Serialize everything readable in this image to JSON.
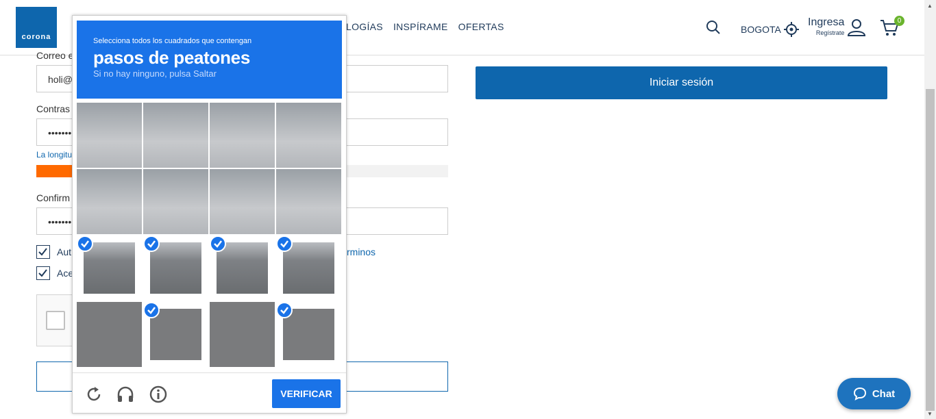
{
  "header": {
    "logo_text": "corona",
    "nav": [
      "LOGÍAS",
      "INSPÍRAME",
      "OFERTAS"
    ],
    "city": "BOGOTA",
    "login_label": "Ingresa",
    "login_sub": "Regístrate",
    "cart_count": "0"
  },
  "form": {
    "email_label": "Correo e",
    "email_value": "holi@",
    "password_label": "Contras",
    "password_value": "•••••••",
    "hint": "La longitu",
    "confirm_label": "Confirm",
    "confirm_value": "•••••••",
    "check1_label": "Aut",
    "check2_label": "Ace",
    "terms_link": "rminos",
    "strength_level": 0.1
  },
  "signin_button": "Iniciar sesión",
  "chat_button": "Chat",
  "captcha": {
    "instruction": "Selecciona todos los cuadrados que contengan",
    "target": "pasos de peatones",
    "sub": "Si no hay ninguno, pulsa Saltar",
    "verify_label": "VERIFICAR",
    "tiles_selected": [
      false,
      false,
      false,
      false,
      false,
      false,
      false,
      false,
      true,
      true,
      true,
      true,
      false,
      true,
      false,
      true
    ]
  },
  "colors": {
    "brand": "#0e66ad",
    "captcha_blue": "#1a73e8",
    "strength": "#ff6a00",
    "badge": "#6ab42d"
  }
}
